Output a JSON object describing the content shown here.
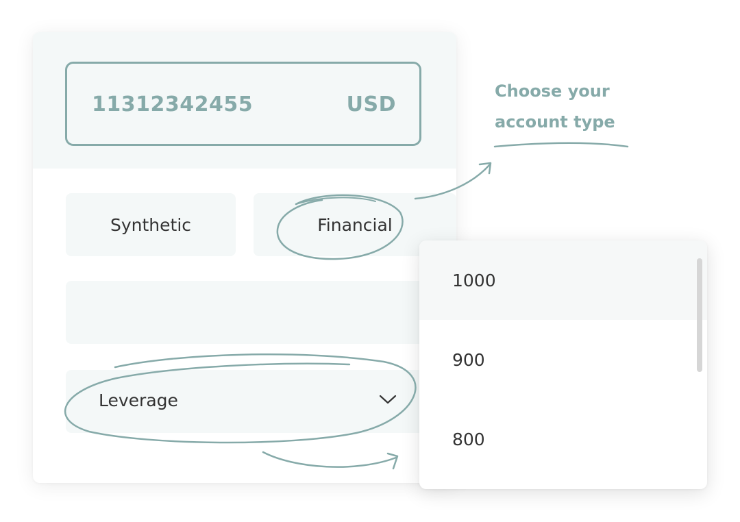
{
  "account": {
    "number": "11312342455",
    "currency": "USD"
  },
  "account_types": [
    {
      "label": "Synthetic"
    },
    {
      "label": "Financial"
    }
  ],
  "leverage": {
    "label": "Leverage",
    "icon": "chevron-down-icon"
  },
  "dropdown": {
    "options": [
      {
        "label": "1000"
      },
      {
        "label": "900"
      },
      {
        "label": "800"
      }
    ],
    "selected": "1000"
  },
  "annotation": {
    "line1": "Choose your",
    "line2": "account type"
  },
  "colors": {
    "accent": "#86aaa9",
    "panel": "#f4f8f8",
    "text": "#333333"
  }
}
